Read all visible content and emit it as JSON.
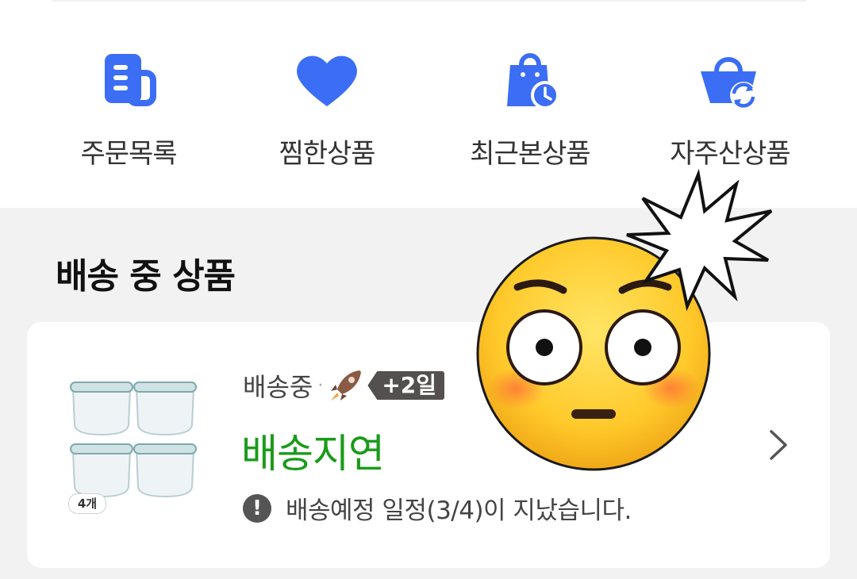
{
  "shortcuts": [
    {
      "label": "주문목록",
      "icon": "order-list-icon"
    },
    {
      "label": "찜한상품",
      "icon": "heart-icon"
    },
    {
      "label": "최근본상품",
      "icon": "recent-bag-icon"
    },
    {
      "label": "자주산상품",
      "icon": "repurchase-basket-icon"
    }
  ],
  "section": {
    "title": "배송 중 상품"
  },
  "delivery_card": {
    "status": "배송중",
    "separator": "·",
    "delay_badge": "+2일",
    "headline": "배송지연",
    "thumbnail_quantity": "4개",
    "notice_icon": "!",
    "notice": "배송예정 일정(3/4)이 지났습니다.",
    "rocket_icon": "rocket-delivery-icon",
    "chevron_icon": "chevron-right-icon"
  },
  "overlay": {
    "emoji": "flushed-face-emoji",
    "burst": "anger-burst"
  },
  "colors": {
    "accent_blue": "#3b6ef5",
    "delay_green": "#1a9b1a",
    "gray_background": "#f2f2f2",
    "badge_dark": "#555050"
  }
}
